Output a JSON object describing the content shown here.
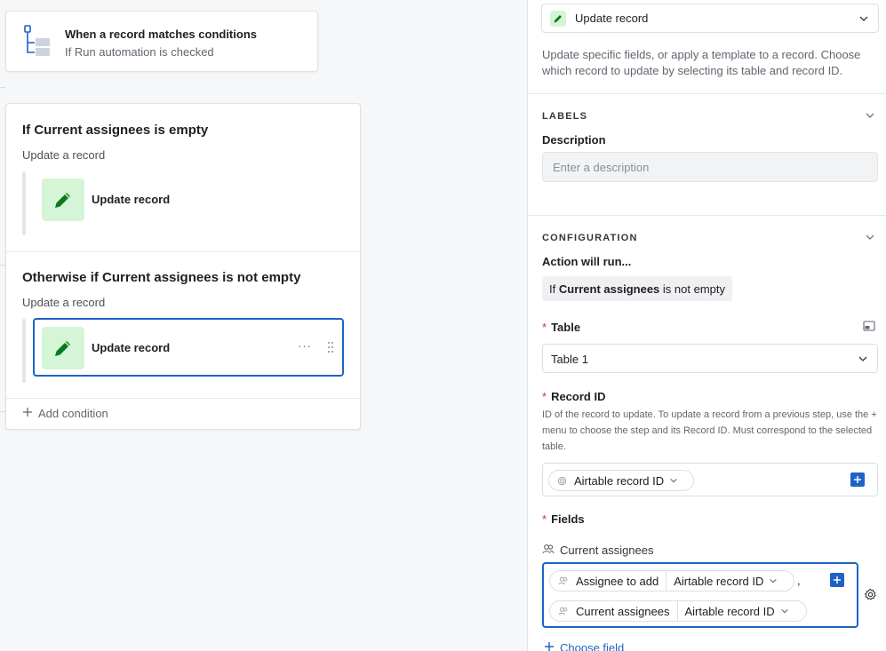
{
  "canvas": {
    "trigger": {
      "title": "When a record matches conditions",
      "subtitle": "If Run automation is checked"
    },
    "conditions": [
      {
        "title": "If Current assignees is empty",
        "subtitle": "Update a record",
        "action_label": "Update record"
      },
      {
        "title": "Otherwise if Current assignees is not empty",
        "subtitle": "Update a record",
        "action_label": "Update record"
      }
    ],
    "more_label": "···",
    "add_condition_label": "Add condition"
  },
  "panel": {
    "action_select": "Update record",
    "description": "Update specific fields, or apply a template to a record. Choose which record to update by selecting its table and record ID.",
    "labels_section": {
      "title": "LABELS",
      "description_label": "Description",
      "description_placeholder": "Enter a description"
    },
    "configuration_section": {
      "title": "CONFIGURATION",
      "action_will_run": "Action will run...",
      "condition_prefix": "If",
      "condition_field": "Current assignees",
      "condition_rest": "is not empty",
      "table_label": "Table",
      "table_value": "Table 1",
      "record_id_label": "Record ID",
      "record_id_hint": "ID of the record to update. To update a record from a previous step, use the + menu to choose the step and its Record ID. Must correspond to the selected table.",
      "record_id_token": "Airtable record ID",
      "fields_label": "Fields",
      "current_assignees_label": "Current assignees",
      "field_tokens": [
        {
          "source": "Assignee to add",
          "value": "Airtable record ID"
        },
        {
          "source": "Current assignees",
          "value": "Airtable record ID"
        }
      ],
      "separator": ",",
      "choose_field": "Choose field"
    }
  },
  "colors": {
    "accent": "#1d63c7",
    "action_green": "#d4f6d6",
    "icon_green": "#0a7a1a",
    "required": "#d32f2f"
  }
}
